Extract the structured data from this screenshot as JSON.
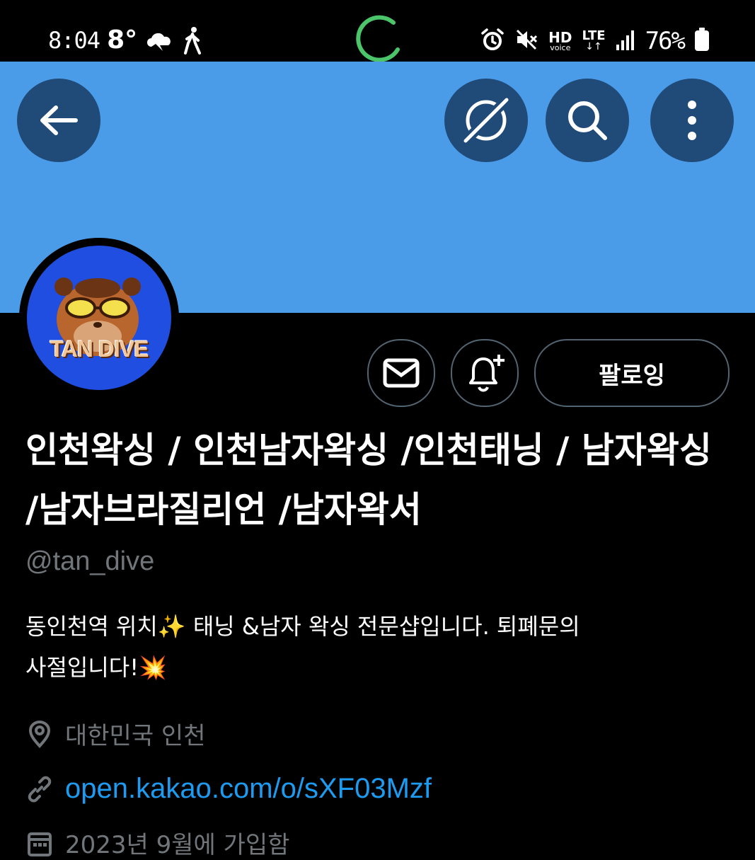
{
  "status_bar": {
    "time": "8:04",
    "temperature": "8°",
    "battery": "76%",
    "hd_label": "HD",
    "hd_sub": "voice",
    "lte_label": "LTE"
  },
  "colors": {
    "banner": "#4a9be8",
    "button_bg": "#204a77",
    "link": "#1d9bf0",
    "muted": "#71767b",
    "loader": "#4cc46a"
  },
  "profile": {
    "avatar_text": "TAN DIVE",
    "follow_label": "팔로잉",
    "display_name": "인천왁싱 / 인천남자왁싱 /인천태닝 / 남자왁싱 /남자브라질리언 /남자왁서",
    "handle": "@tan_dive",
    "bio_line1": "동인천역 위치✨  태닝 &남자 왁싱 전문샵입니다. 퇴폐문의",
    "bio_line2": "사절입니다!💥",
    "location": "대한민국 인천",
    "link": "open.kakao.com/o/sXF03Mzf",
    "joined": "2023년 9월에 가입함"
  },
  "icons": {
    "back": "arrow-left-icon",
    "incognito": "incognito-icon",
    "search": "search-icon",
    "more": "more-vertical-icon",
    "message": "mail-icon",
    "notify": "bell-plus-icon",
    "location": "location-pin-icon",
    "link": "link-icon",
    "calendar": "calendar-icon"
  }
}
